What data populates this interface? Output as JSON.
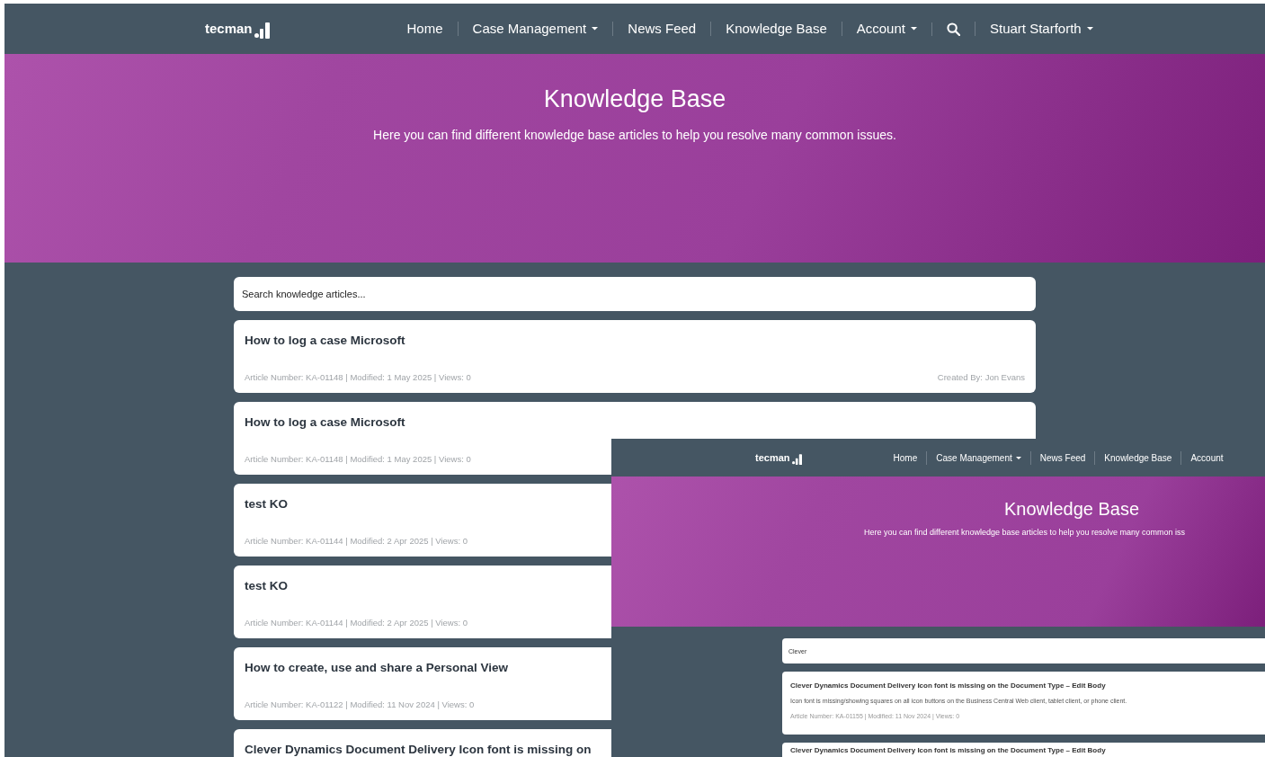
{
  "nav": {
    "logo": "tecman",
    "items": [
      {
        "kind": "link",
        "label": "Home"
      },
      {
        "kind": "dropdown",
        "label": "Case Management"
      },
      {
        "kind": "link",
        "label": "News Feed"
      },
      {
        "kind": "link",
        "label": "Knowledge Base"
      },
      {
        "kind": "dropdown",
        "label": "Account"
      },
      {
        "kind": "search"
      },
      {
        "kind": "dropdown",
        "label": "Stuart Starforth"
      }
    ]
  },
  "hero": {
    "title": "Knowledge Base",
    "subtitle": "Here you can find different knowledge base articles to help you resolve many common issues."
  },
  "search": {
    "placeholder": "Search knowledge articles..."
  },
  "articles": [
    {
      "title": "How to log a case Microsoft",
      "meta": "Article Number: KA-01148 | Modified: 1 May 2025 | Views: 0",
      "author": "Created By: Jon Evans"
    },
    {
      "title": "How to log a case Microsoft",
      "meta": "Article Number: KA-01148 | Modified: 1 May 2025 | Views: 0"
    },
    {
      "title": "test KO",
      "meta": "Article Number: KA-01144 | Modified: 2 Apr 2025 | Views: 0"
    },
    {
      "title": "test KO",
      "meta": "Article Number: KA-01144 | Modified: 2 Apr 2025 | Views: 0"
    },
    {
      "title": "How to create, use and share a Personal View",
      "meta": "Article Number: KA-01122 | Modified: 11 Nov 2024 | Views: 0"
    },
    {
      "title": "Clever Dynamics Document Delivery Icon font is missing on"
    }
  ],
  "inset": {
    "nav": {
      "logo": "tecman",
      "items": [
        {
          "kind": "link",
          "label": "Home"
        },
        {
          "kind": "dropdown",
          "label": "Case Management"
        },
        {
          "kind": "link",
          "label": "News Feed"
        },
        {
          "kind": "link",
          "label": "Knowledge Base"
        },
        {
          "kind": "link",
          "label": "Account"
        }
      ]
    },
    "hero": {
      "title": "Knowledge Base",
      "subtitle": "Here you can find different knowledge base articles to help you resolve many common iss"
    },
    "search": {
      "value": "Clever"
    },
    "articles": [
      {
        "title": "Clever Dynamics Document Delivery Icon font is missing on the Document Type – Edit Body",
        "summary": "Icon font is missing/showing squares on all icon buttons on the Business Central Web client, tablet client, or phone client.",
        "meta": "Article Number: KA-01155 | Modified: 11 Nov 2024 | Views: 0"
      },
      {
        "title": "Clever Dynamics Document Delivery Icon font is missing on the Document Type – Edit Body"
      }
    ]
  }
}
